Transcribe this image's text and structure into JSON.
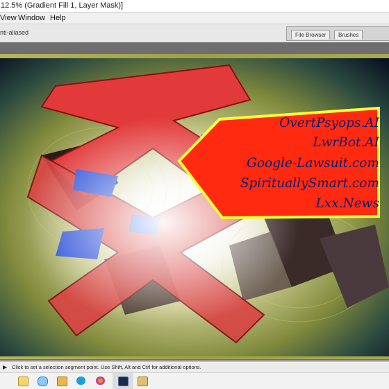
{
  "window": {
    "title": "12.5% (Gradient Fill 1, Layer Mask)]"
  },
  "menu": {
    "items": [
      "View",
      "Window",
      "Help"
    ]
  },
  "options_bar": {
    "antialias_label": "nti-aliased"
  },
  "palette_well": {
    "tabs": [
      "File Browser",
      "Brushes"
    ]
  },
  "artwork": {
    "sign_lines": [
      "OvertPsyops.AI",
      "LwrBot.AI",
      "Google-Lawsuit.com",
      "SpirituallySmart.com",
      "Lxx.News"
    ],
    "colors": {
      "sign_fill": "#ff2a10",
      "sign_border": "#f4ff3a",
      "sign_text": "#0a1a70",
      "cross_red": "#e23a3a",
      "accent_blue": "#2b4fd8"
    }
  },
  "status_bar": {
    "message": "Click to set a selection segment point.  Use Shift, Alt and Ctrl for additional options."
  },
  "taskbar": {
    "icons": [
      "file-explorer-icon",
      "snipping-tool-icon",
      "folder-icon",
      "edge-browser-icon",
      "firefox-icon",
      "photoshop-icon",
      "app-icon"
    ]
  }
}
